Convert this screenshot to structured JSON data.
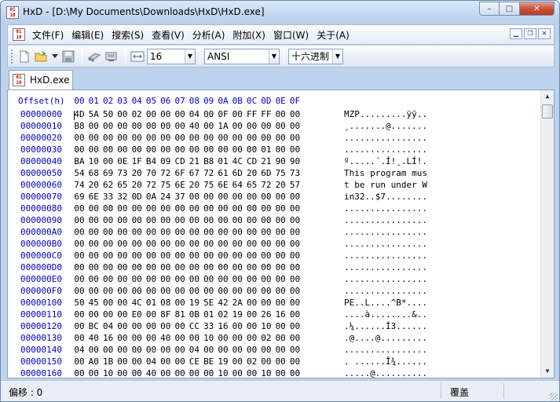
{
  "window": {
    "title": "HxD - [D:\\My Documents\\Downloads\\HxD\\HxD.exe]",
    "caption_min": "–",
    "caption_max": "□",
    "caption_close": "✕"
  },
  "menu": {
    "items": [
      "文件(F)",
      "编辑(E)",
      "搜索(S)",
      "查看(V)",
      "分析(A)",
      "附加(X)",
      "窗口(W)",
      "关于(A)"
    ]
  },
  "toolbar": {
    "bytes_per_row": "16",
    "charset": "ANSI",
    "offset_base": "十六进制"
  },
  "tab": {
    "label": "HxD.exe"
  },
  "editor": {
    "header_offset": "Offset(h)",
    "header_columns": [
      "00",
      "01",
      "02",
      "03",
      "04",
      "05",
      "06",
      "07",
      "08",
      "09",
      "0A",
      "0B",
      "0C",
      "0D",
      "0E",
      "0F"
    ],
    "rows": [
      {
        "offset": "00000000",
        "bytes": [
          "4D",
          "5A",
          "50",
          "00",
          "02",
          "00",
          "00",
          "00",
          "04",
          "00",
          "0F",
          "00",
          "FF",
          "FF",
          "00",
          "00"
        ],
        "ascii": "MZP.........ÿÿ.."
      },
      {
        "offset": "00000010",
        "bytes": [
          "B8",
          "00",
          "00",
          "00",
          "00",
          "00",
          "00",
          "00",
          "40",
          "00",
          "1A",
          "00",
          "00",
          "00",
          "00",
          "00"
        ],
        "ascii": "¸.......@......."
      },
      {
        "offset": "00000020",
        "bytes": [
          "00",
          "00",
          "00",
          "00",
          "00",
          "00",
          "00",
          "00",
          "00",
          "00",
          "00",
          "00",
          "00",
          "00",
          "00",
          "00"
        ],
        "ascii": "................"
      },
      {
        "offset": "00000030",
        "bytes": [
          "00",
          "00",
          "00",
          "00",
          "00",
          "00",
          "00",
          "00",
          "00",
          "00",
          "00",
          "00",
          "00",
          "01",
          "00",
          "00"
        ],
        "ascii": "................"
      },
      {
        "offset": "00000040",
        "bytes": [
          "BA",
          "10",
          "00",
          "0E",
          "1F",
          "B4",
          "09",
          "CD",
          "21",
          "B8",
          "01",
          "4C",
          "CD",
          "21",
          "90",
          "90"
        ],
        "ascii": "º.....´.Í!¸.LÍ!."
      },
      {
        "offset": "00000050",
        "bytes": [
          "54",
          "68",
          "69",
          "73",
          "20",
          "70",
          "72",
          "6F",
          "67",
          "72",
          "61",
          "6D",
          "20",
          "6D",
          "75",
          "73"
        ],
        "ascii": "This program mus"
      },
      {
        "offset": "00000060",
        "bytes": [
          "74",
          "20",
          "62",
          "65",
          "20",
          "72",
          "75",
          "6E",
          "20",
          "75",
          "6E",
          "64",
          "65",
          "72",
          "20",
          "57"
        ],
        "ascii": "t be run under W"
      },
      {
        "offset": "00000070",
        "bytes": [
          "69",
          "6E",
          "33",
          "32",
          "0D",
          "0A",
          "24",
          "37",
          "00",
          "00",
          "00",
          "00",
          "00",
          "00",
          "00",
          "00"
        ],
        "ascii": "in32..$7........"
      },
      {
        "offset": "00000080",
        "bytes": [
          "00",
          "00",
          "00",
          "00",
          "00",
          "00",
          "00",
          "00",
          "00",
          "00",
          "00",
          "00",
          "00",
          "00",
          "00",
          "00"
        ],
        "ascii": "................"
      },
      {
        "offset": "00000090",
        "bytes": [
          "00",
          "00",
          "00",
          "00",
          "00",
          "00",
          "00",
          "00",
          "00",
          "00",
          "00",
          "00",
          "00",
          "00",
          "00",
          "00"
        ],
        "ascii": "................"
      },
      {
        "offset": "000000A0",
        "bytes": [
          "00",
          "00",
          "00",
          "00",
          "00",
          "00",
          "00",
          "00",
          "00",
          "00",
          "00",
          "00",
          "00",
          "00",
          "00",
          "00"
        ],
        "ascii": "................"
      },
      {
        "offset": "000000B0",
        "bytes": [
          "00",
          "00",
          "00",
          "00",
          "00",
          "00",
          "00",
          "00",
          "00",
          "00",
          "00",
          "00",
          "00",
          "00",
          "00",
          "00"
        ],
        "ascii": "................"
      },
      {
        "offset": "000000C0",
        "bytes": [
          "00",
          "00",
          "00",
          "00",
          "00",
          "00",
          "00",
          "00",
          "00",
          "00",
          "00",
          "00",
          "00",
          "00",
          "00",
          "00"
        ],
        "ascii": "................"
      },
      {
        "offset": "000000D0",
        "bytes": [
          "00",
          "00",
          "00",
          "00",
          "00",
          "00",
          "00",
          "00",
          "00",
          "00",
          "00",
          "00",
          "00",
          "00",
          "00",
          "00"
        ],
        "ascii": "................"
      },
      {
        "offset": "000000E0",
        "bytes": [
          "00",
          "00",
          "00",
          "00",
          "00",
          "00",
          "00",
          "00",
          "00",
          "00",
          "00",
          "00",
          "00",
          "00",
          "00",
          "00"
        ],
        "ascii": "................"
      },
      {
        "offset": "000000F0",
        "bytes": [
          "00",
          "00",
          "00",
          "00",
          "00",
          "00",
          "00",
          "00",
          "00",
          "00",
          "00",
          "00",
          "00",
          "00",
          "00",
          "00"
        ],
        "ascii": "................"
      },
      {
        "offset": "00000100",
        "bytes": [
          "50",
          "45",
          "00",
          "00",
          "4C",
          "01",
          "08",
          "00",
          "19",
          "5E",
          "42",
          "2A",
          "00",
          "00",
          "00",
          "00"
        ],
        "ascii": "PE..L....^B*...."
      },
      {
        "offset": "00000110",
        "bytes": [
          "00",
          "00",
          "00",
          "00",
          "E0",
          "00",
          "8F",
          "81",
          "0B",
          "01",
          "02",
          "19",
          "00",
          "26",
          "16",
          "00"
        ],
        "ascii": "....à........&.."
      },
      {
        "offset": "00000120",
        "bytes": [
          "00",
          "BC",
          "04",
          "00",
          "00",
          "00",
          "00",
          "00",
          "CC",
          "33",
          "16",
          "00",
          "00",
          "10",
          "00",
          "00"
        ],
        "ascii": ".¼......Ì3......"
      },
      {
        "offset": "00000130",
        "bytes": [
          "00",
          "40",
          "16",
          "00",
          "00",
          "00",
          "40",
          "00",
          "00",
          "10",
          "00",
          "00",
          "00",
          "02",
          "00",
          "00"
        ],
        "ascii": ".@....@........."
      },
      {
        "offset": "00000140",
        "bytes": [
          "04",
          "00",
          "00",
          "00",
          "00",
          "00",
          "00",
          "00",
          "04",
          "00",
          "00",
          "00",
          "00",
          "00",
          "00",
          "00"
        ],
        "ascii": "................"
      },
      {
        "offset": "00000150",
        "bytes": [
          "00",
          "A0",
          "1B",
          "00",
          "00",
          "04",
          "00",
          "00",
          "CE",
          "BE",
          "19",
          "00",
          "02",
          "00",
          "00",
          "00"
        ],
        "ascii": ". ......Î¾......"
      },
      {
        "offset": "00000160",
        "bytes": [
          "00",
          "00",
          "10",
          "00",
          "00",
          "40",
          "00",
          "00",
          "00",
          "00",
          "10",
          "00",
          "00",
          "10",
          "00",
          "00"
        ],
        "ascii": ".....@.........."
      }
    ]
  },
  "status": {
    "offset_text": "偏移 : 0",
    "mode": "覆盖"
  }
}
